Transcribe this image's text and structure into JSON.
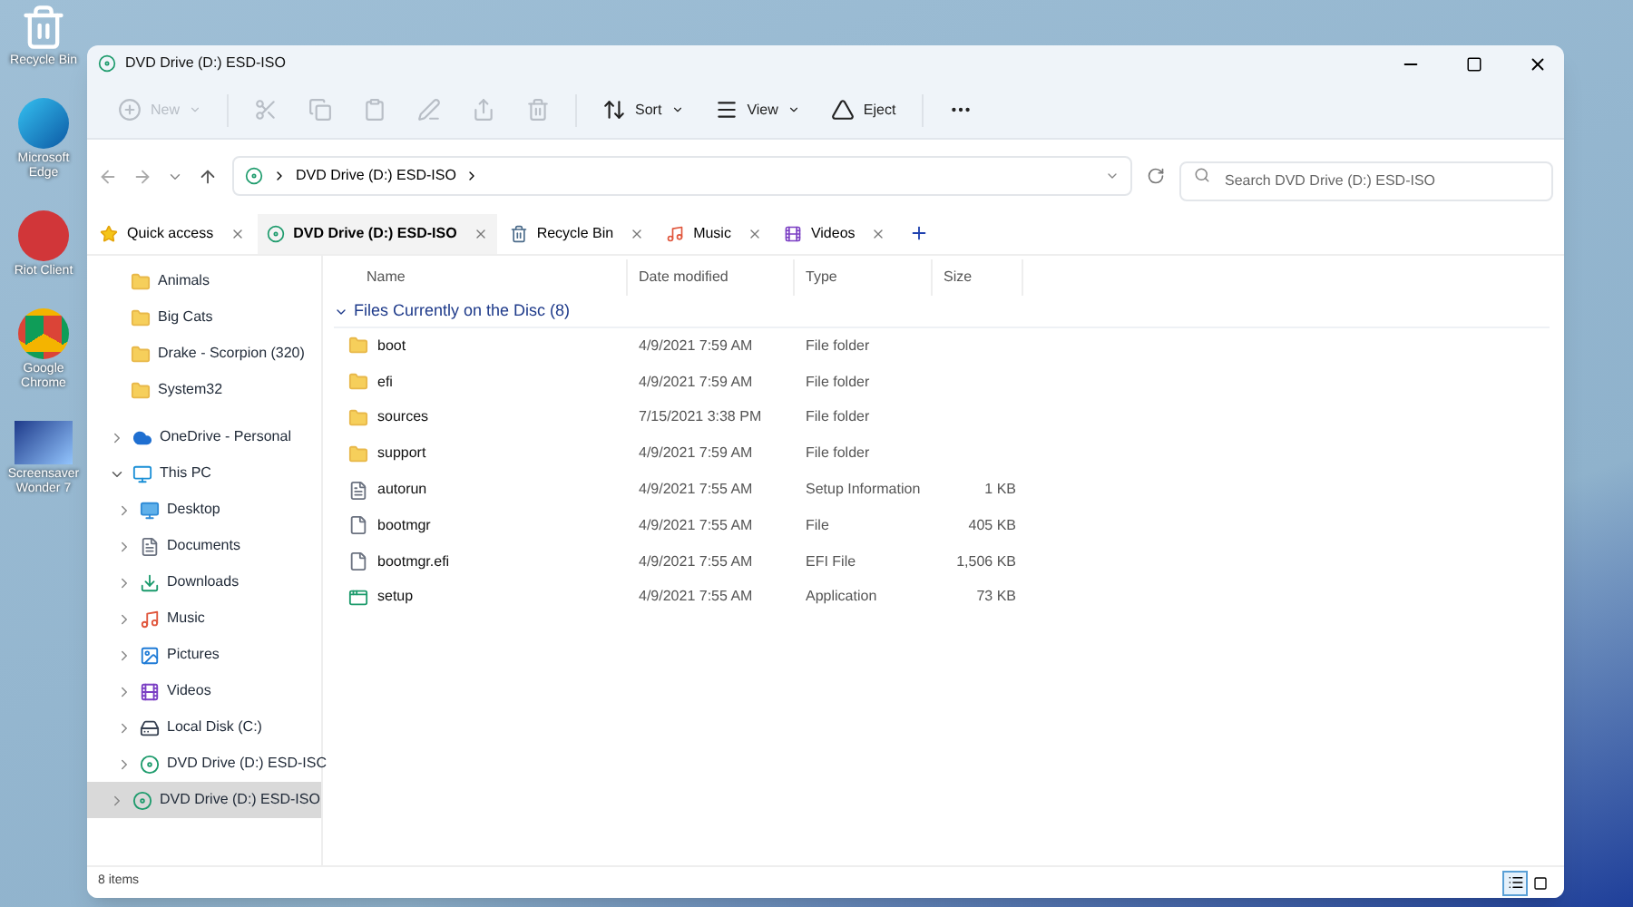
{
  "desktop_icons": [
    {
      "kind": "bin",
      "label": "Recycle Bin"
    },
    {
      "kind": "edge",
      "label": "Microsoft Edge"
    },
    {
      "kind": "riot",
      "label": "Riot Client"
    },
    {
      "kind": "chrome",
      "label": "Google Chrome"
    },
    {
      "kind": "screensaver",
      "label": "Screensaver Wonder 7"
    }
  ],
  "window": {
    "title": "DVD Drive (D:) ESD-ISO"
  },
  "toolbar": [
    {
      "kind": "new",
      "label": "New",
      "disabled": true
    },
    {
      "kind": "cut",
      "disabled": true
    },
    {
      "kind": "copy",
      "disabled": true
    },
    {
      "kind": "paste",
      "disabled": true
    },
    {
      "kind": "rename",
      "disabled": true
    },
    {
      "kind": "share",
      "disabled": true
    },
    {
      "kind": "delete",
      "disabled": true
    },
    {
      "kind": "sort",
      "label": "Sort",
      "disabled": false
    },
    {
      "kind": "view",
      "label": "View",
      "disabled": false
    },
    {
      "kind": "eject",
      "label": "Eject",
      "disabled": false
    },
    {
      "kind": "more",
      "disabled": false
    }
  ],
  "address": {
    "path": "DVD Drive (D:) ESD-ISO"
  },
  "search": {
    "placeholder": "Search DVD Drive (D:) ESD-ISO"
  },
  "tabs": [
    {
      "kind": "star",
      "label": "Quick access",
      "selected": false
    },
    {
      "kind": "dvd",
      "label": "DVD Drive (D:) ESD-ISO",
      "selected": true
    },
    {
      "kind": "bin",
      "label": "Recycle Bin",
      "selected": false
    },
    {
      "kind": "music",
      "label": "Music",
      "selected": false
    },
    {
      "kind": "videos",
      "label": "Videos",
      "selected": false
    }
  ],
  "sidebar": {
    "pinned": [
      {
        "kind": "folder",
        "label": "Animals",
        "selected": false
      },
      {
        "kind": "folder",
        "label": "Big Cats",
        "selected": false
      },
      {
        "kind": "folder",
        "label": "Drake - Scorpion (320)",
        "selected": false
      },
      {
        "kind": "folder",
        "label": "System32",
        "selected": false
      }
    ],
    "items": [
      {
        "kind": "cloud",
        "label": "OneDrive - Personal",
        "expanded": false,
        "selected": false
      },
      {
        "kind": "pc",
        "label": "This PC",
        "expanded": true,
        "selected": false,
        "children": [
          {
            "kind": "desktop",
            "label": "Desktop",
            "expanded": false,
            "selected": false
          },
          {
            "kind": "documents",
            "label": "Documents",
            "expanded": false,
            "selected": false
          },
          {
            "kind": "downloads",
            "label": "Downloads",
            "expanded": false,
            "selected": false
          },
          {
            "kind": "music",
            "label": "Music",
            "expanded": false,
            "selected": false
          },
          {
            "kind": "pictures",
            "label": "Pictures",
            "expanded": false,
            "selected": false
          },
          {
            "kind": "videos",
            "label": "Videos",
            "expanded": false,
            "selected": false
          },
          {
            "kind": "disk",
            "label": "Local Disk (C:)",
            "expanded": false,
            "selected": false
          },
          {
            "kind": "dvd",
            "label": "DVD Drive (D:) ESD-ISC",
            "expanded": false,
            "selected": false
          }
        ]
      },
      {
        "kind": "dvd",
        "label": "DVD Drive (D:) ESD-ISO",
        "expanded": false,
        "selected": true
      }
    ]
  },
  "table": {
    "columns": [
      "Name",
      "Date modified",
      "Type",
      "Size"
    ],
    "group": "Files Currently on the Disc (8)",
    "rows": [
      {
        "kind": "folder",
        "name": "boot",
        "date": "4/9/2021 7:59 AM",
        "type": "File folder"
      },
      {
        "kind": "folder",
        "name": "efi",
        "date": "4/9/2021 7:59 AM",
        "type": "File folder"
      },
      {
        "kind": "folder",
        "name": "sources",
        "date": "7/15/2021 3:38 PM",
        "type": "File folder"
      },
      {
        "kind": "folder",
        "name": "support",
        "date": "4/9/2021 7:59 AM",
        "type": "File folder"
      },
      {
        "kind": "info",
        "name": "autorun",
        "date": "4/9/2021 7:55 AM",
        "type": "Setup Information",
        "size": "1 KB"
      },
      {
        "kind": "file",
        "name": "bootmgr",
        "date": "4/9/2021 7:55 AM",
        "type": "File",
        "size": "405 KB"
      },
      {
        "kind": "file",
        "name": "bootmgr.efi",
        "date": "4/9/2021 7:55 AM",
        "type": "EFI File",
        "size": "1,506 KB"
      },
      {
        "kind": "app",
        "name": "setup",
        "date": "4/9/2021 7:55 AM",
        "type": "Application",
        "size": "73 KB"
      }
    ]
  },
  "status_bar": {
    "count": "8 items",
    "views": [
      {
        "kind": "details",
        "selected": true
      },
      {
        "kind": "tiles",
        "selected": false
      }
    ]
  }
}
